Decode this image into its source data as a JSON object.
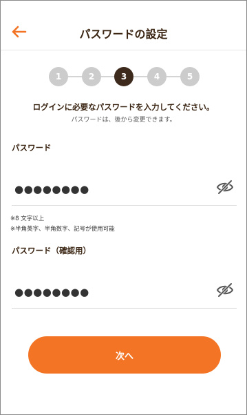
{
  "header": {
    "title": "パスワードの設定",
    "back_icon": "arrow-left-icon"
  },
  "steps": {
    "items": [
      "1",
      "2",
      "3",
      "4",
      "5"
    ],
    "current": 3
  },
  "instruction": "ログインに必要なパスワードを入力してください。",
  "sub_instruction": "パスワードは、後から変更できます。",
  "password": {
    "label": "パスワード",
    "value": "●●●●●●●●",
    "toggle_icon": "eye-off-icon",
    "notes": [
      "※8 文字以上",
      "※半角英字、半角数字、記号が使用可能"
    ]
  },
  "password_confirm": {
    "label": "パスワード（確認用）",
    "value": "●●●●●●●●",
    "toggle_icon": "eye-off-icon"
  },
  "next_button": "次へ",
  "colors": {
    "accent": "#f27424",
    "brown": "#3d2a1c",
    "inactive_step": "#cccccc"
  }
}
